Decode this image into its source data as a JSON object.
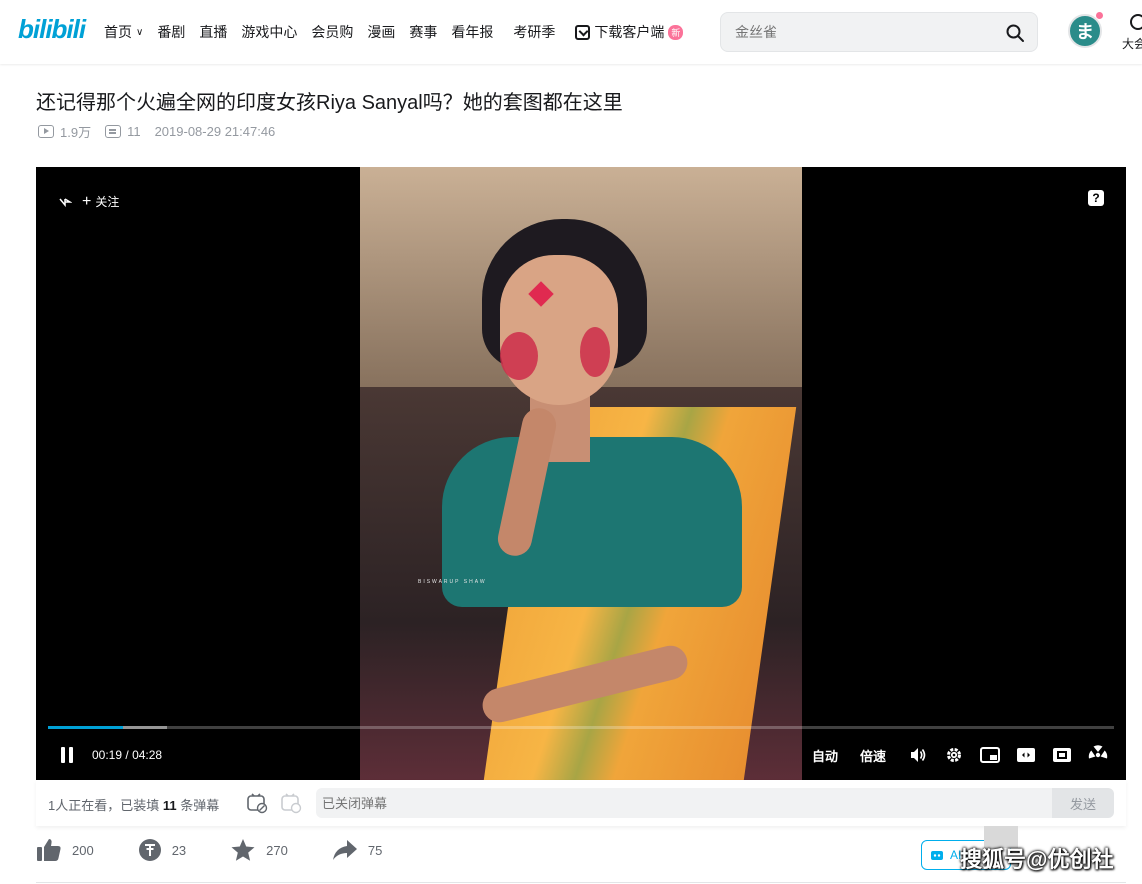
{
  "header": {
    "logo": "bilibili",
    "nav": [
      "首页",
      "番剧",
      "直播",
      "游戏中心",
      "会员购",
      "漫画",
      "赛事",
      "看年报",
      "考研季"
    ],
    "download": "下载客户端",
    "new_badge": "新",
    "search_placeholder": "金丝雀",
    "avatar_glyph": "ま",
    "vip_label": "大会"
  },
  "video": {
    "title": "还记得那个火遍全网的印度女孩Riya Sanyal吗？她的套图都在这里",
    "views": "1.9万",
    "danmaku_count": "11",
    "date": "2019-08-29 21:47:46"
  },
  "player": {
    "follow": "关注",
    "help": "?",
    "photo_watermark": "BISWARUP SHAW",
    "current_time": "00:19",
    "duration": "04:28",
    "time_sep": "/",
    "played_fraction": 0.07,
    "buffered_fraction": 0.112,
    "auto": "自动",
    "speed": "倍速"
  },
  "danmaku_bar": {
    "viewers_prefix": "1人正在看，已装填",
    "viewers_count": "11",
    "viewers_suffix": "条弹幕",
    "input_placeholder": "已关闭弹幕",
    "send": "发送"
  },
  "actions": {
    "like": "200",
    "coin": "23",
    "favorite": "270",
    "share": "75",
    "ai_label": "AI"
  },
  "overlay": {
    "sohu_watermark": "搜狐号@优创社"
  },
  "colors": {
    "brand": "#00a1d6",
    "pink": "#fb7299"
  }
}
